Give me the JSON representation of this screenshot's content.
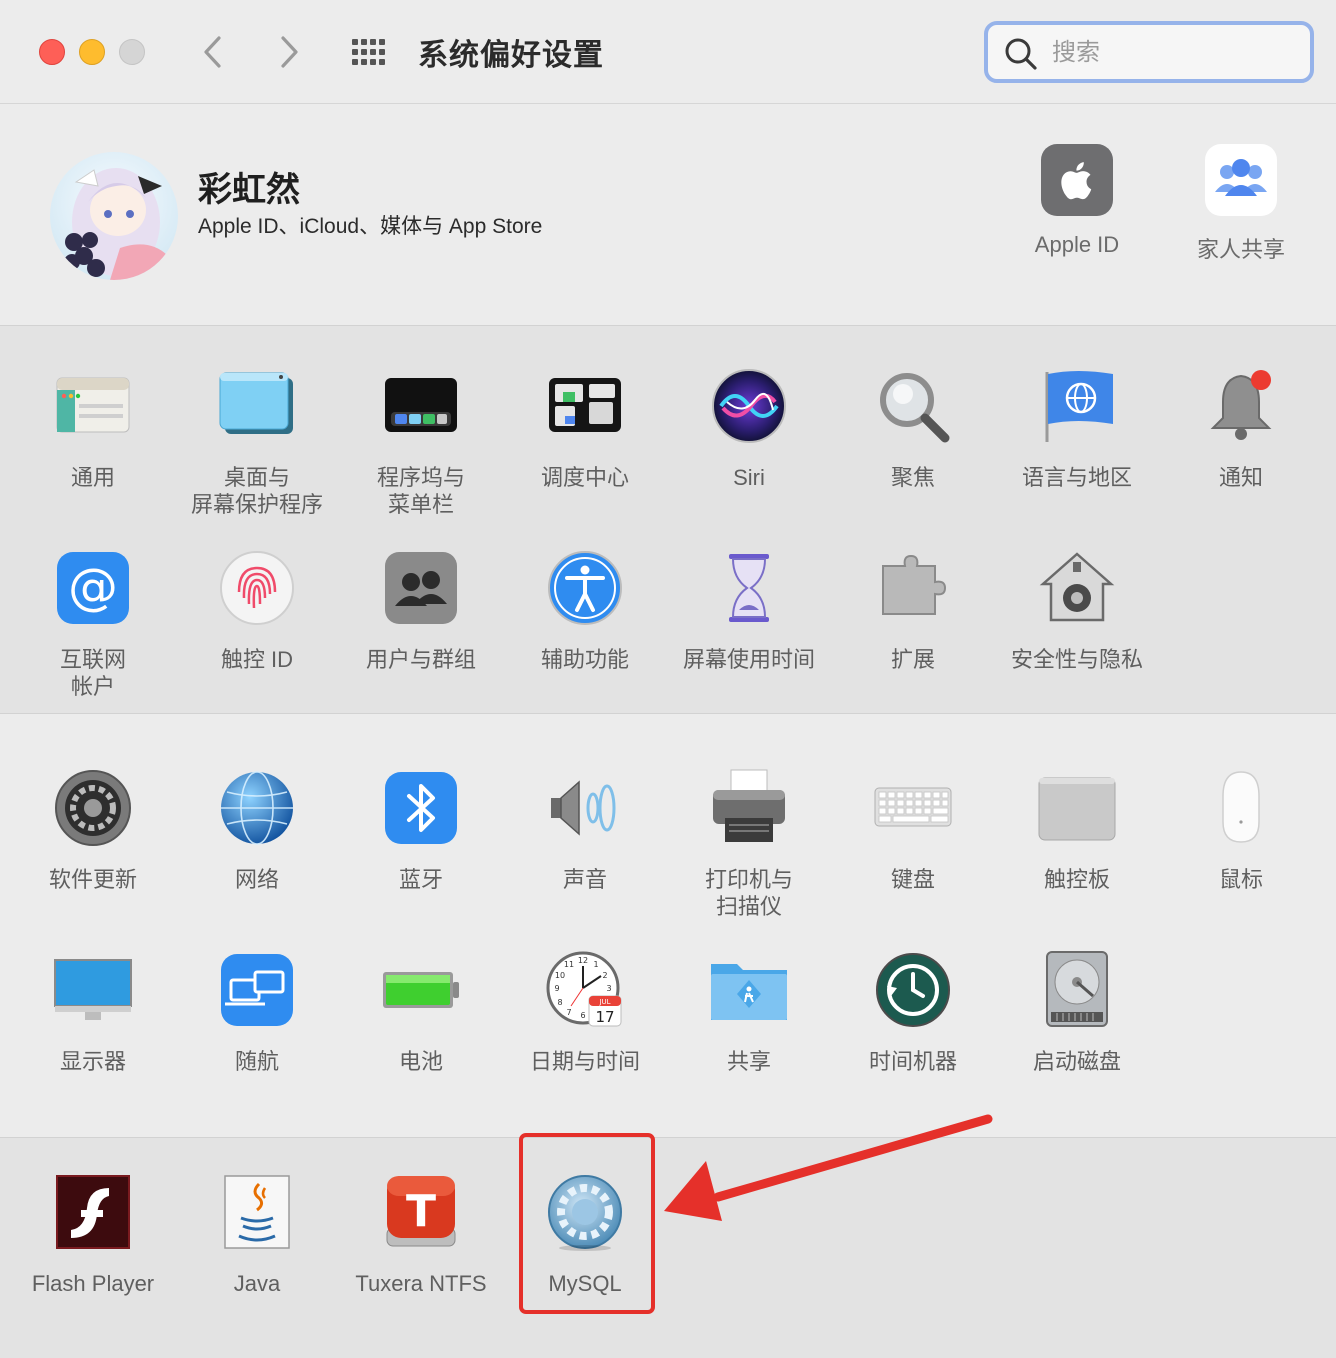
{
  "window": {
    "title": "系统偏好设置"
  },
  "search": {
    "placeholder": "搜索",
    "value": ""
  },
  "account": {
    "name": "彩虹然",
    "subtitle": "Apple ID、iCloud、媒体与 App Store",
    "items": [
      {
        "label": "Apple ID",
        "icon": "apple-logo-icon"
      },
      {
        "label": "家人共享",
        "icon": "family-sharing-icon"
      }
    ]
  },
  "row1": [
    {
      "label": "通用"
    },
    {
      "label": "桌面与\n屏幕保护程序"
    },
    {
      "label": "程序坞与\n菜单栏"
    },
    {
      "label": "调度中心"
    },
    {
      "label": "Siri"
    },
    {
      "label": "聚焦"
    },
    {
      "label": "语言与地区"
    },
    {
      "label": "通知"
    }
  ],
  "row2": [
    {
      "label": "互联网\n帐户"
    },
    {
      "label": "触控 ID"
    },
    {
      "label": "用户与群组"
    },
    {
      "label": "辅助功能"
    },
    {
      "label": "屏幕使用时间"
    },
    {
      "label": "扩展"
    },
    {
      "label": "安全性与隐私"
    }
  ],
  "row3": [
    {
      "label": "软件更新"
    },
    {
      "label": "网络"
    },
    {
      "label": "蓝牙"
    },
    {
      "label": "声音"
    },
    {
      "label": "打印机与\n扫描仪"
    },
    {
      "label": "键盘"
    },
    {
      "label": "触控板"
    },
    {
      "label": "鼠标"
    }
  ],
  "row4": [
    {
      "label": "显示器"
    },
    {
      "label": "随航"
    },
    {
      "label": "电池"
    },
    {
      "label": "日期与时间",
      "calendar_month": "JUL",
      "calendar_day": "17"
    },
    {
      "label": "共享"
    },
    {
      "label": "时间机器"
    },
    {
      "label": "启动磁盘"
    }
  ],
  "third_party": [
    {
      "label": "Flash Player"
    },
    {
      "label": "Java"
    },
    {
      "label": "Tuxera NTFS",
      "icon_letter": "T"
    },
    {
      "label": "MySQL"
    }
  ],
  "annotation": {
    "highlight_color": "#e5302a",
    "target": "MySQL"
  }
}
